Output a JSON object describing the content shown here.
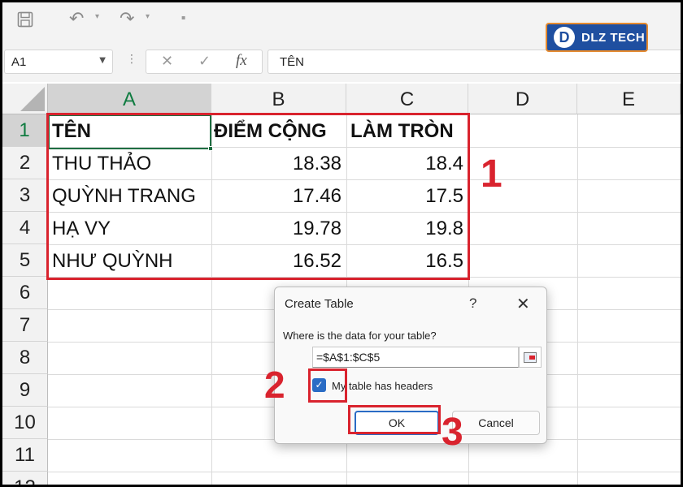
{
  "app": {
    "logo_mark": "D",
    "logo_text": "DLZ TECH"
  },
  "toolbar": {
    "save_icon": "save-icon",
    "undo_icon": "undo-icon",
    "redo_icon": "redo-icon"
  },
  "formula_bar": {
    "name_box": "A1",
    "fx_label": "fx",
    "cancel_glyph": "✕",
    "enter_glyph": "✓",
    "value": "TÊN"
  },
  "sheet": {
    "columns": [
      "A",
      "B",
      "C",
      "D",
      "E"
    ],
    "rows": [
      "1",
      "2",
      "3",
      "4",
      "5",
      "6",
      "7",
      "8",
      "9",
      "10",
      "11",
      "12"
    ],
    "cells": {
      "A1": "TÊN",
      "B1": "ĐIỂM CỘNG",
      "C1": "LÀM TRÒN",
      "A2": "THU THẢO",
      "B2": "18.38",
      "C2": "18.4",
      "A3": "QUỲNH TRANG",
      "B3": "17.46",
      "C3": "17.5",
      "A4": "HẠ VY",
      "B4": "19.78",
      "C4": "19.8",
      "A5": "NHƯ QUỲNH",
      "B5": "16.52",
      "C5": "16.5"
    }
  },
  "annotations": {
    "step1": "1",
    "step2": "2",
    "step3": "3"
  },
  "dialog": {
    "title": "Create Table",
    "help": "?",
    "close": "✕",
    "prompt": "Where is the data for your table?",
    "range": "=$A$1:$C$5",
    "headers_label": "My table has headers",
    "headers_checked": true,
    "check_glyph": "✓",
    "ok_label": "OK",
    "cancel_label": "Cancel"
  },
  "colors": {
    "accent_green": "#107c41",
    "annotation_red": "#d9232e",
    "dialog_blue": "#2a6cc5"
  }
}
